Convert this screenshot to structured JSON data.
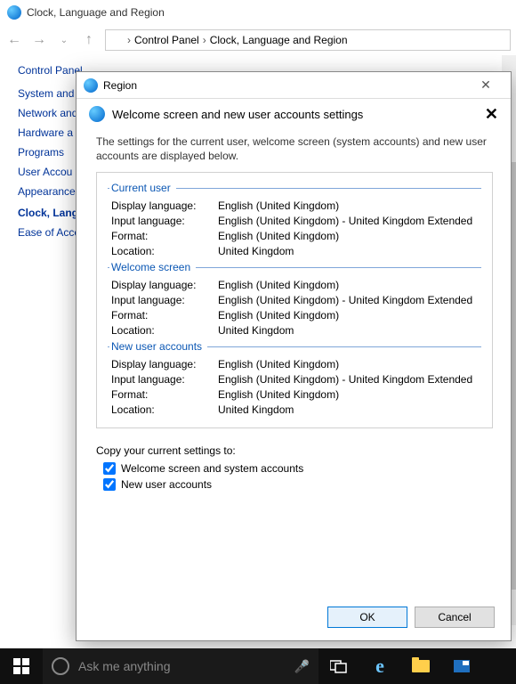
{
  "cp": {
    "title": "Clock, Language and Region",
    "breadcrumb": [
      "Control Panel",
      "Clock, Language and Region"
    ],
    "sideTitle": "Control Panel",
    "links": [
      "System and",
      "Network and",
      "Hardware a",
      "Programs",
      "User Accou",
      "Appearance\nPersonalisa",
      "Clock, Lang",
      "Ease of Acce"
    ]
  },
  "dialog": {
    "title": "Region",
    "header": "Welcome screen and new user accounts settings",
    "intro": "The settings for the current user, welcome screen (system accounts) and new user accounts are displayed below.",
    "sections": [
      {
        "title": "Current user",
        "rows": [
          {
            "label": "Display language:",
            "value": "English (United Kingdom)"
          },
          {
            "label": "Input language:",
            "value": "English (United Kingdom) - United Kingdom Extended"
          },
          {
            "label": "Format:",
            "value": "English (United Kingdom)"
          },
          {
            "label": "Location:",
            "value": "United Kingdom"
          }
        ]
      },
      {
        "title": "Welcome screen",
        "rows": [
          {
            "label": "Display language:",
            "value": "English (United Kingdom)"
          },
          {
            "label": "Input language:",
            "value": "English (United Kingdom) - United Kingdom Extended"
          },
          {
            "label": "Format:",
            "value": "English (United Kingdom)"
          },
          {
            "label": "Location:",
            "value": "United Kingdom"
          }
        ]
      },
      {
        "title": "New user accounts",
        "rows": [
          {
            "label": "Display language:",
            "value": "English (United Kingdom)"
          },
          {
            "label": "Input language:",
            "value": "English (United Kingdom) - United Kingdom Extended"
          },
          {
            "label": "Format:",
            "value": "English (United Kingdom)"
          },
          {
            "label": "Location:",
            "value": "United Kingdom"
          }
        ]
      }
    ],
    "copyLabel": "Copy your current settings to:",
    "checkbox1": "Welcome screen and system accounts",
    "checkbox2": "New user accounts",
    "ok": "OK",
    "cancel": "Cancel"
  },
  "taskbar": {
    "searchPlaceholder": "Ask me anything"
  }
}
